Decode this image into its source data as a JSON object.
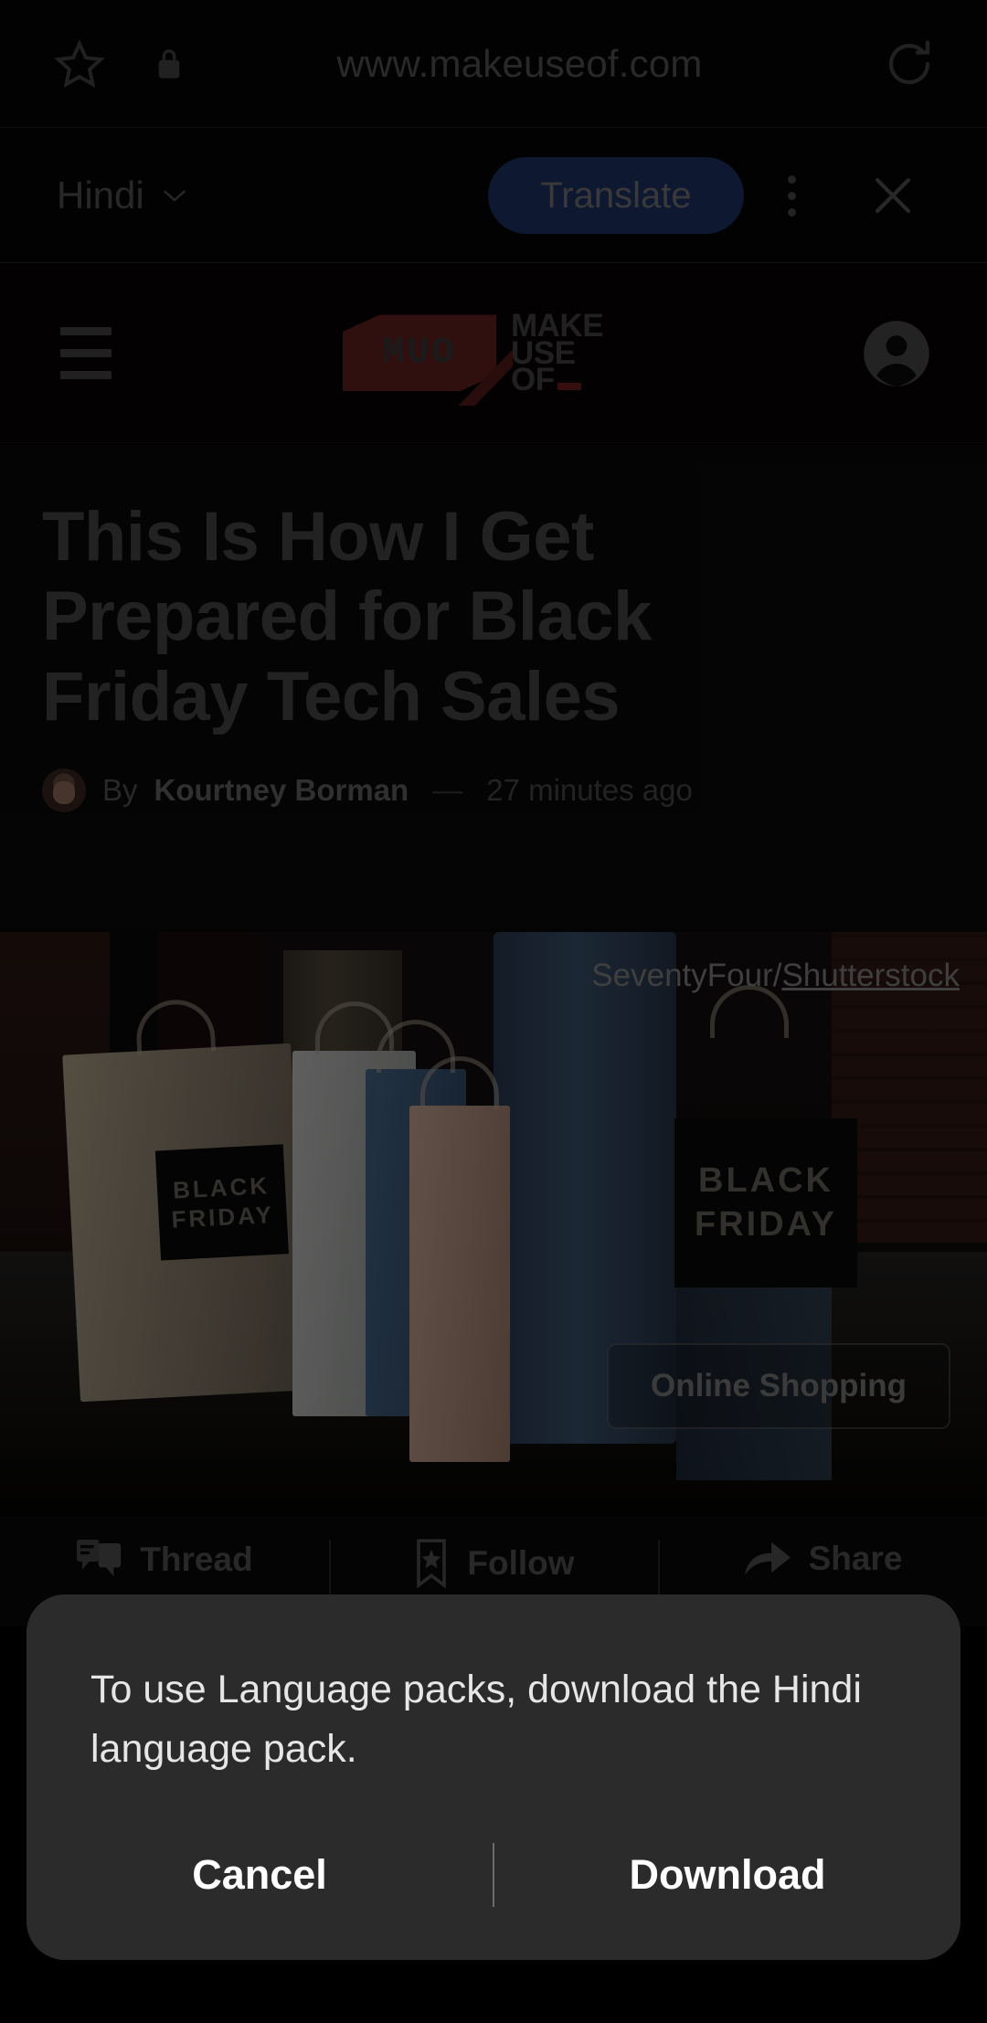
{
  "browser": {
    "url": "www.makeuseof.com",
    "bookmark_icon": "star-icon",
    "security_icon": "lock-icon",
    "reload_icon": "reload-icon"
  },
  "translate_bar": {
    "language": "Hindi",
    "chevron_icon": "chevron-down-icon",
    "translate_label": "Translate",
    "menu_icon": "kebab-menu-icon",
    "close_icon": "close-icon",
    "accent_color": "#21366b"
  },
  "site_header": {
    "menu_icon": "hamburger-icon",
    "logo_mark_text": "MUO",
    "logo_line1": "MAKE",
    "logo_line2": "USE",
    "logo_line3": "OF",
    "logo_brand_color": "#6b2222",
    "account_icon": "account-circle-icon"
  },
  "article": {
    "headline": "This Is How I Get Prepared for Black Friday Tech Sales",
    "byline_prefix": "By",
    "author": "Kourtney Borman",
    "separator": "—",
    "timestamp": "27 minutes ago",
    "avatar_icon": "author-avatar"
  },
  "hero": {
    "credit_prefix": "SeventyFour/",
    "credit_link": "Shutterstock",
    "tag_label": "Online Shopping",
    "bag_label_line1": "BLACK",
    "bag_label_line2": "FRIDAY"
  },
  "action_bar": {
    "items": [
      {
        "label": "Thread",
        "icon": "comment-thread-icon"
      },
      {
        "label": "Follow",
        "icon": "bookmark-star-icon"
      },
      {
        "label": "Share",
        "icon": "share-arrow-icon"
      }
    ]
  },
  "dialog": {
    "message": "To use Language packs, download the Hindi language pack.",
    "cancel_label": "Cancel",
    "download_label": "Download",
    "background_color": "#2b2b2b"
  }
}
